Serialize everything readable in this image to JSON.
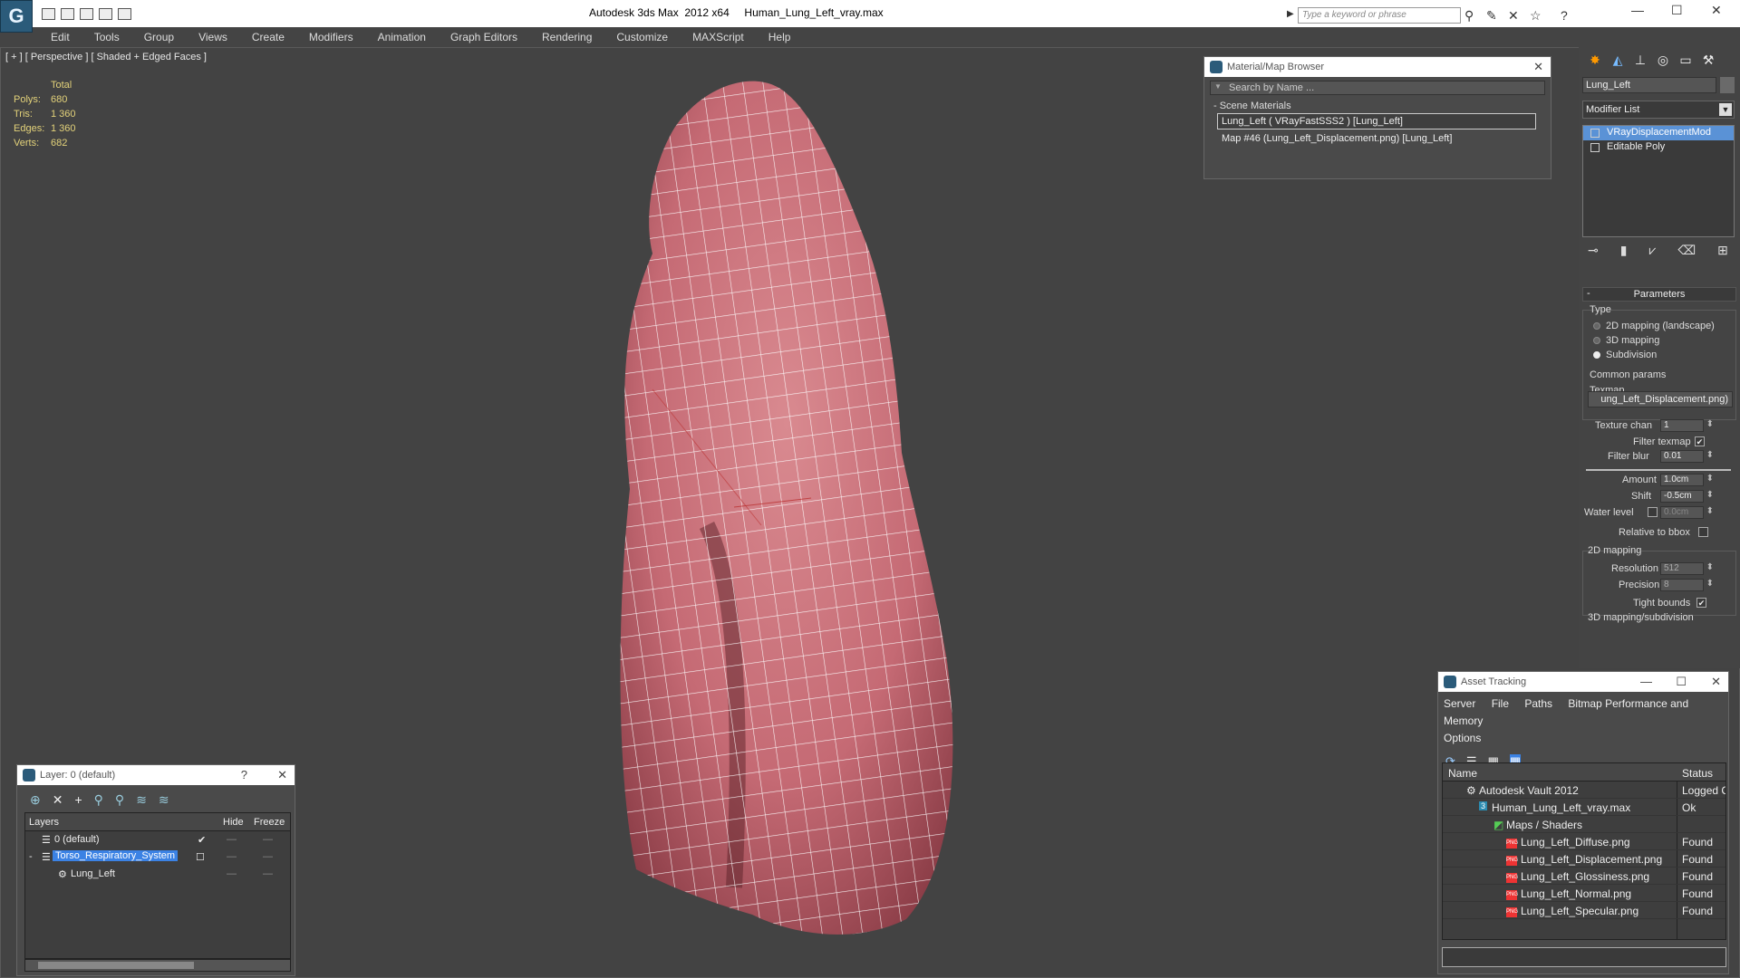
{
  "app": {
    "title": "Autodesk 3ds Max  2012 x64     Human_Lung_Left_vray.max",
    "search_placeholder": "Type a keyword or phrase"
  },
  "menu": [
    "Edit",
    "Tools",
    "Group",
    "Views",
    "Create",
    "Modifiers",
    "Animation",
    "Graph Editors",
    "Rendering",
    "Customize",
    "MAXScript",
    "Help"
  ],
  "viewport": {
    "label": "[ + ] [ Perspective ] [ Shaded + Edged Faces ]",
    "stats": {
      "header": "Total",
      "rows": [
        {
          "label": "Polys:",
          "value": "680"
        },
        {
          "label": "Tris:",
          "value": "1 360"
        },
        {
          "label": "Edges:",
          "value": "1 360"
        },
        {
          "label": "Verts:",
          "value": "682"
        }
      ]
    }
  },
  "material_browser": {
    "title": "Material/Map Browser",
    "search": "Search by Name ...",
    "section": "- Scene Materials",
    "items": [
      "Lung_Left  ( VRayFastSSS2 )  [Lung_Left]",
      "Map #46 (Lung_Left_Displacement.png)  [Lung_Left]"
    ]
  },
  "command_panel": {
    "object_name": "Lung_Left",
    "modifier_list": "Modifier List",
    "stack": [
      "VRayDisplacementMod",
      "Editable Poly"
    ],
    "parameters": "Parameters",
    "type_label": "Type",
    "type_options": [
      "2D mapping (landscape)",
      "3D mapping",
      "Subdivision"
    ],
    "common_params": "Common params",
    "texmap_label": "Texmap",
    "texmap_value": "ung_Left_Displacement.png)",
    "texture_chan": {
      "label": "Texture chan",
      "value": "1"
    },
    "filter_texmap": "Filter texmap",
    "filter_blur": {
      "label": "Filter blur",
      "value": "0.01"
    },
    "amount": {
      "label": "Amount",
      "value": "1.0cm"
    },
    "shift": {
      "label": "Shift",
      "value": "-0.5cm"
    },
    "water_level": {
      "label": "Water level",
      "value": "0.0cm"
    },
    "relative_bbox": "Relative to bbox",
    "mapping2d": "2D mapping",
    "resolution": {
      "label": "Resolution",
      "value": "512"
    },
    "precision": {
      "label": "Precision",
      "value": "8"
    },
    "tight_bounds": "Tight bounds",
    "mapping3d": "3D mapping/subdivision"
  },
  "layer_panel": {
    "title": "Layer: 0 (default)",
    "col_layers": "Layers",
    "col_hide": "Hide",
    "col_freeze": "Freeze",
    "rows": [
      "0 (default)",
      "Torso_Respiratory_System",
      "Lung_Left"
    ]
  },
  "asset_tracking": {
    "title": "Asset Tracking",
    "menu": [
      "Server",
      "File",
      "Paths",
      "Bitmap Performance and Memory",
      "Options"
    ],
    "col_name": "Name",
    "col_status": "Status",
    "rows": [
      {
        "name": "Autodesk Vault 2012",
        "status": "Logged C"
      },
      {
        "name": "Human_Lung_Left_vray.max",
        "status": "Ok"
      },
      {
        "name": "Maps / Shaders",
        "status": ""
      },
      {
        "name": "Lung_Left_Diffuse.png",
        "status": "Found"
      },
      {
        "name": "Lung_Left_Displacement.png",
        "status": "Found"
      },
      {
        "name": "Lung_Left_Glossiness.png",
        "status": "Found"
      },
      {
        "name": "Lung_Left_Normal.png",
        "status": "Found"
      },
      {
        "name": "Lung_Left_Specular.png",
        "status": "Found"
      }
    ]
  }
}
